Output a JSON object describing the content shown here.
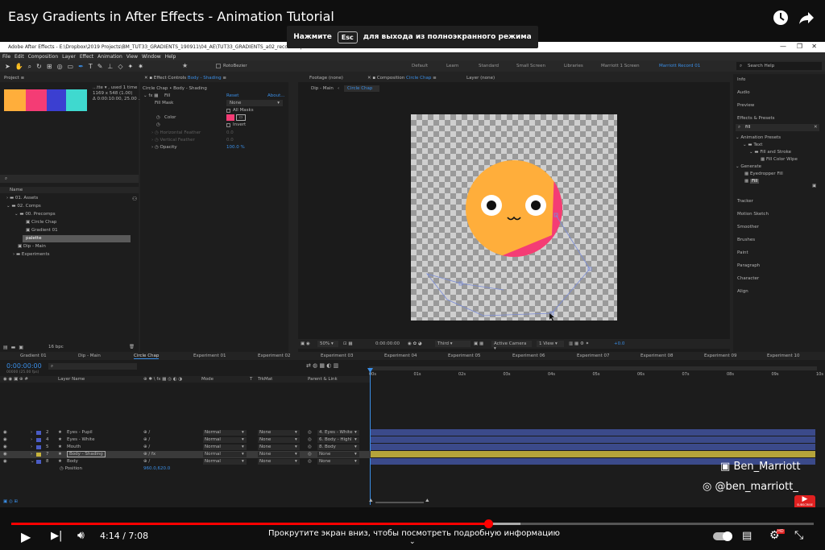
{
  "video": {
    "title": "Easy Gradients in After Effects - Animation Tutorial",
    "time": "4:14 / 7:08",
    "scroll_hint": "Прокрутите экран вниз, чтобы посмотреть подробную информацию"
  },
  "toast": {
    "before": "Нажмите",
    "key": "Esc",
    "after": "для выхода из полноэкранного режима"
  },
  "watermark": {
    "line1": "Ben_Marriott",
    "line2": "@ben_marriott_",
    "subscribe": "SUBSCRIBE"
  },
  "app": {
    "window_title": "Adobe After Effects - E:\\Dropbox\\2019 Projects\\BM_TUT33_GRADIENTS_190911\\04_AE\\TUT33_GRADIENTS_a02_record.aep",
    "menu": [
      "File",
      "Edit",
      "Composition",
      "Layer",
      "Effect",
      "Animation",
      "View",
      "Window",
      "Help"
    ],
    "rotobezier": "RotoBezier",
    "workspaces": [
      "Default",
      "Learn",
      "Standard",
      "Small Screen",
      "Libraries",
      "Marriott 1 Screen",
      "Marriott Record 01"
    ],
    "search_help": "Search Help",
    "project": {
      "tab": "Project",
      "info1": "...tte ▾ , used 1 time",
      "info2": "1169 x 548 (1.00)",
      "info3": "Δ 0:00:10:00, 25.00 ...",
      "col_name": "Name",
      "bpc": "16 bpc",
      "swatches": [
        "#ffae3b",
        "#f43c75",
        "#3b3fd1",
        "#3fd9cf"
      ],
      "items": [
        "01. Assets",
        "02. Comps",
        "00. Precomps",
        "Circle Chap",
        "Gradient 01",
        "palette",
        "Dip - Main",
        "Experiments"
      ]
    },
    "effect_controls": {
      "tab": "Effect Controls",
      "tab_layer": "Body - Shading",
      "header": "Circle Chap • Body - Shading",
      "fx": "Fill",
      "reset": "Reset",
      "about": "About...",
      "fill_mask": "Fill Mask",
      "fill_mask_value": "None",
      "all_masks": "All Masks",
      "color": "Color",
      "invert": "Invert",
      "h_feather": "Horizontal Feather",
      "h_val": "0.0",
      "v_feather": "Vertical Feather",
      "v_val": "0.0",
      "opacity": "Opacity",
      "opacity_val": "100.0 %",
      "fill_color": "#f43c75"
    },
    "viewer": {
      "tab_footage": "Footage (none)",
      "tab_comp": "Composition",
      "tab_comp_name": "Circle Chap",
      "tab_layer": "Layer (none)",
      "crumb1": "Dip - Main",
      "crumb2": "Circle Chap",
      "zoom": "50%",
      "timecode": "0:00:00:00",
      "resolution": "Third",
      "camera": "Active Camera",
      "views": "1 View",
      "exposure": "+0.0"
    },
    "right_panels": [
      "Info",
      "Audio",
      "Preview",
      "Effects & Presets",
      "Tracker",
      "Motion Sketch",
      "Smoother",
      "Brushes",
      "Paint",
      "Paragraph",
      "Character",
      "Align"
    ],
    "effects_search": "fill",
    "effects_tree": [
      "Animation Presets",
      "Text",
      "Fill and Stroke",
      "Fill Color Wipe",
      "Generate",
      "Eyedropper Fill",
      "Fill"
    ],
    "timeline": {
      "tabs": [
        "Gradient 01",
        "Dip - Main",
        "Circle Chap",
        "Experiment 01",
        "Experiment 02",
        "Experiment 03",
        "Experiment 04",
        "Experiment 05",
        "Experiment 06",
        "Experiment 07",
        "Experiment 08",
        "Experiment 09",
        "Experiment 10"
      ],
      "timecode": "0:00:00:00",
      "timecode_sub": "00000 (25.00 fps)",
      "cols": {
        "layer_name": "Layer Name",
        "mode": "Mode",
        "t": "T",
        "trkmat": "TrkMat",
        "parent": "Parent & Link"
      },
      "ruler": [
        "00s",
        "01s",
        "02s",
        "03s",
        "04s",
        "05s",
        "06s",
        "07s",
        "08s",
        "09s",
        "10s"
      ],
      "layers": [
        {
          "num": "2",
          "name": "Eyes - Pupil",
          "mode": "Normal",
          "trk": "None",
          "parent": "4. Eyes - White",
          "color": "#4a5cc5",
          "bar": "#3b4a8a"
        },
        {
          "num": "4",
          "name": "Eyes - White",
          "mode": "Normal",
          "trk": "None",
          "parent": "6. Body - Highl",
          "color": "#4a5cc5",
          "bar": "#3b4a8a"
        },
        {
          "num": "5",
          "name": "Mouth",
          "mode": "Normal",
          "trk": "None",
          "parent": "8. Body",
          "color": "#4a5cc5",
          "bar": "#3b4a8a"
        },
        {
          "num": "7",
          "name": "Body - Shading",
          "mode": "Normal",
          "trk": "None",
          "parent": "None",
          "color": "#c8b43c",
          "bar": "#b5a43a"
        },
        {
          "num": "8",
          "name": "Body",
          "mode": "Normal",
          "trk": "None",
          "parent": "None",
          "color": "#4a5cc5",
          "bar": "#3b4a8a"
        }
      ],
      "position_label": "Position",
      "position_value": "960.0,620.0"
    }
  }
}
